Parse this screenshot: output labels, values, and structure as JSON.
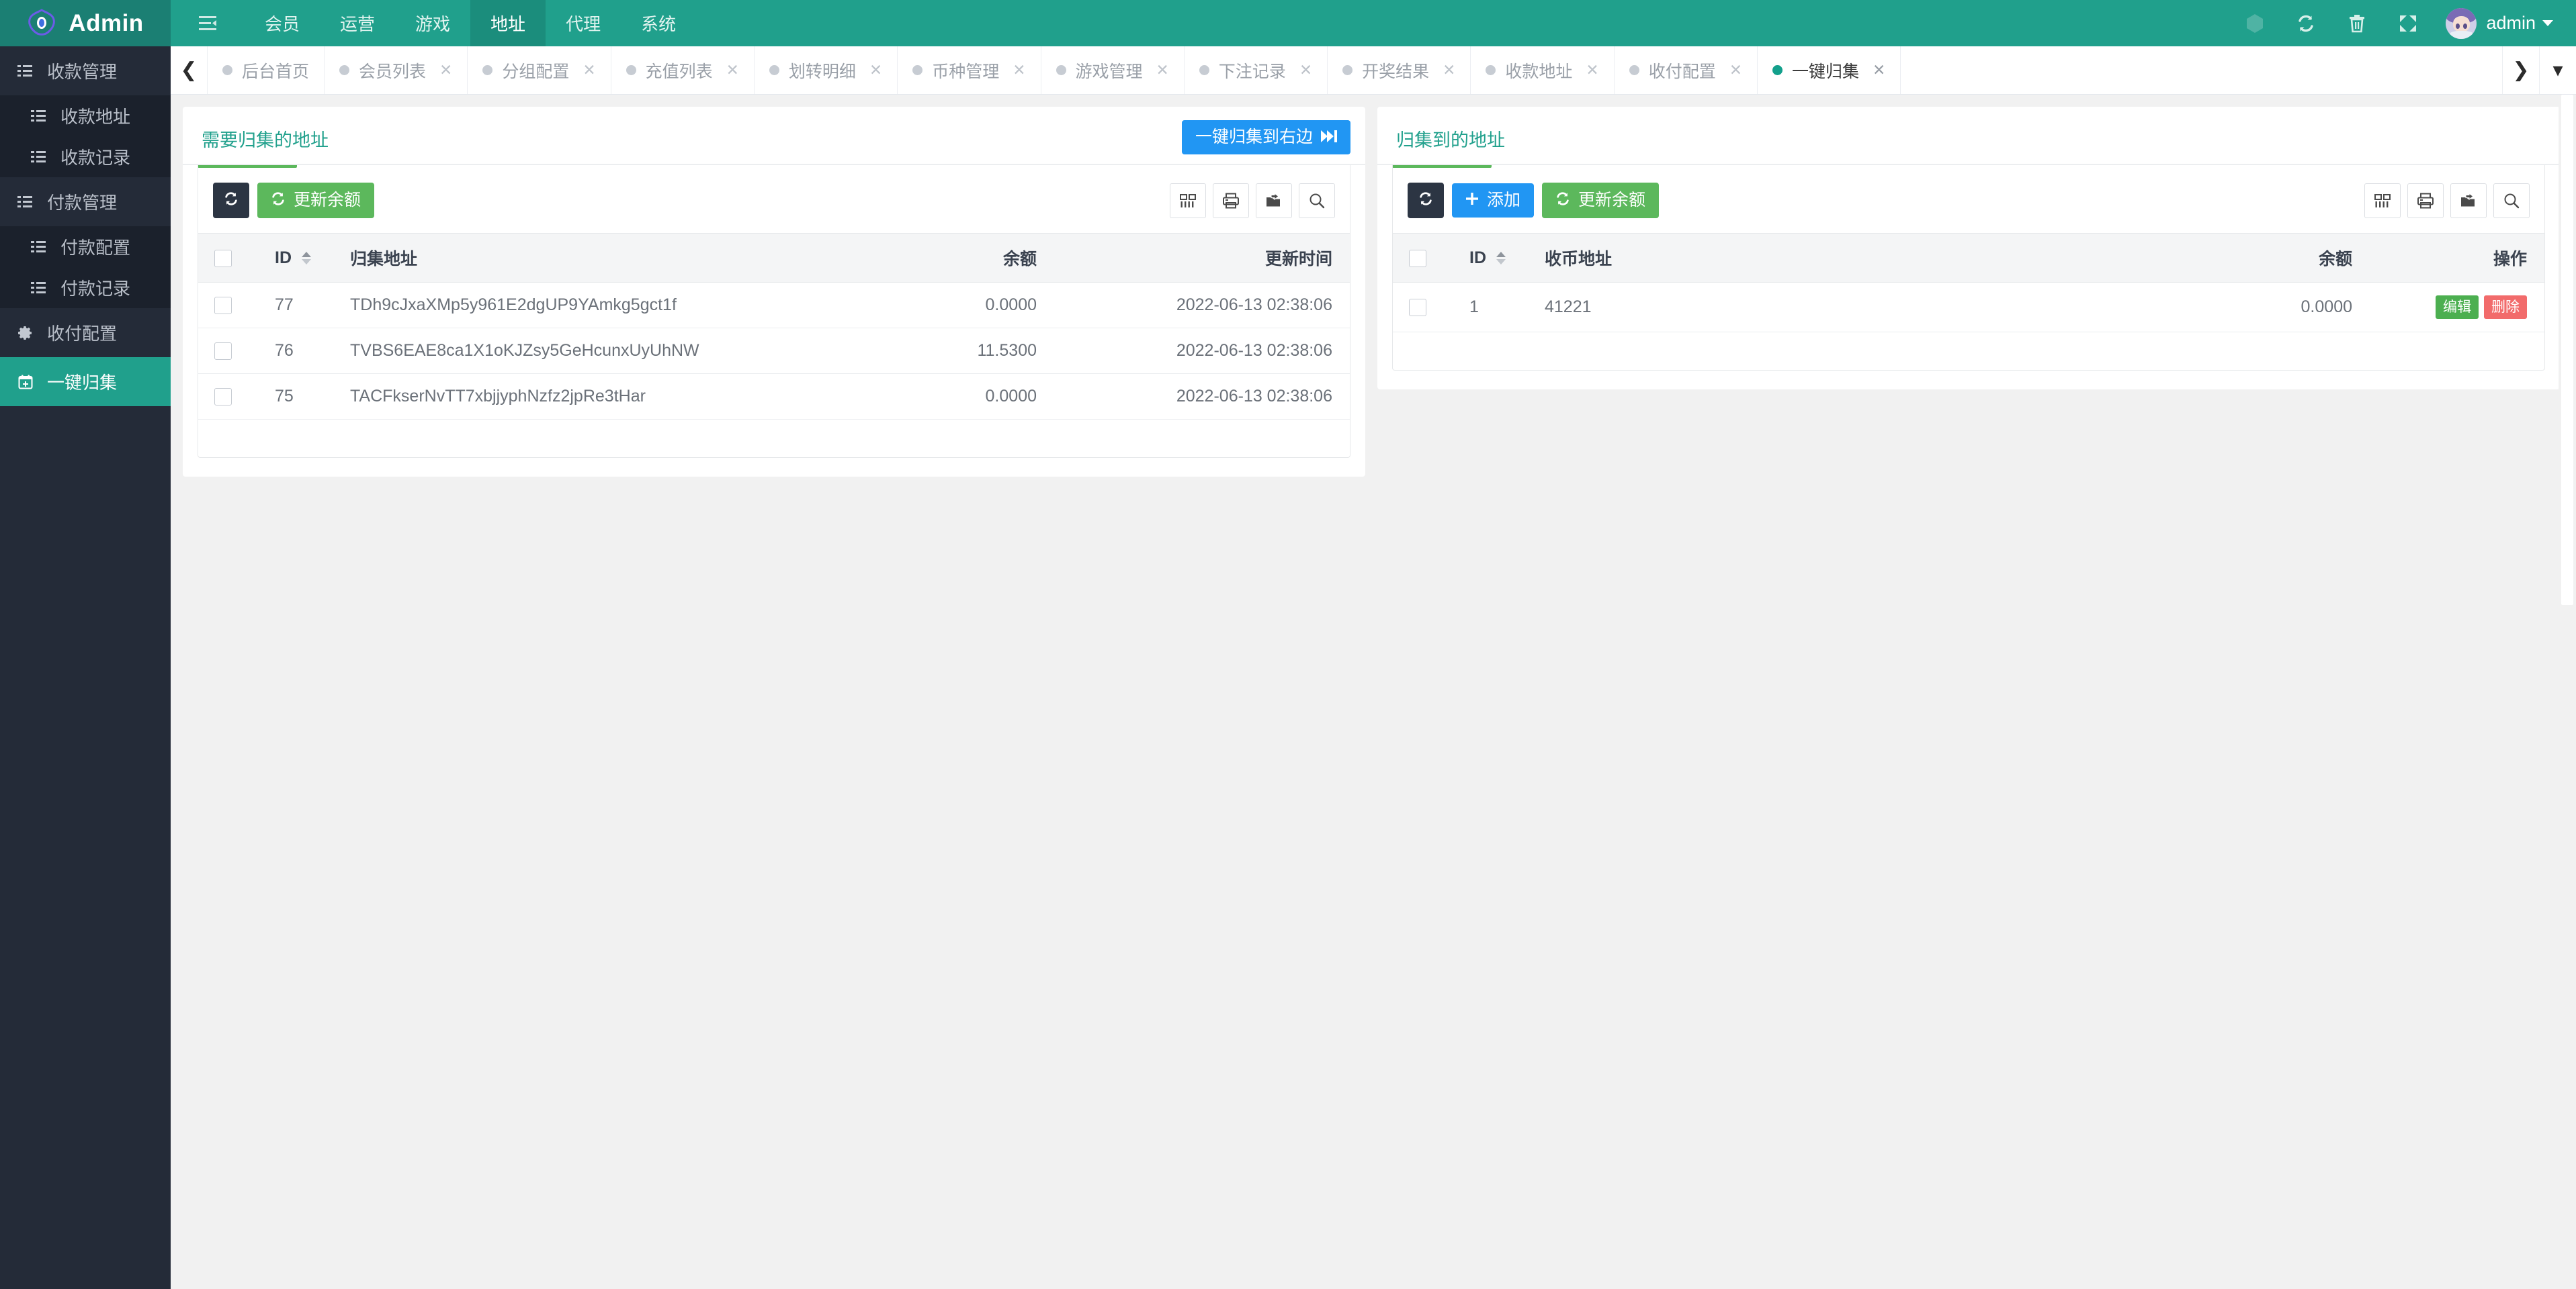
{
  "header": {
    "logo_text": "Admin",
    "logo_icon": "hexagon-eye-logo-icon",
    "collapse_icon": "menu-collapse-icon",
    "nav": [
      {
        "label": "会员",
        "active": false
      },
      {
        "label": "运营",
        "active": false
      },
      {
        "label": "游戏",
        "active": false
      },
      {
        "label": "地址",
        "active": true
      },
      {
        "label": "代理",
        "active": false
      },
      {
        "label": "系统",
        "active": false
      }
    ],
    "right_icons": [
      {
        "name": "hexagon-icon",
        "glyph": "⬢"
      },
      {
        "name": "refresh-icon",
        "glyph": "⟳"
      },
      {
        "name": "trash-icon",
        "glyph": "🗑"
      },
      {
        "name": "fullscreen-icon",
        "glyph": "⤢"
      }
    ],
    "user_name": "admin",
    "avatar_name": "user-avatar"
  },
  "tabbar": {
    "scroll_left_icon": "chevron-left-icon",
    "scroll_right_icon": "chevron-right-icon",
    "dropdown_icon": "chevron-down-icon",
    "tabs": [
      {
        "label": "后台首页",
        "active": false,
        "closable": false
      },
      {
        "label": "会员列表",
        "active": false,
        "closable": true
      },
      {
        "label": "分组配置",
        "active": false,
        "closable": true
      },
      {
        "label": "充值列表",
        "active": false,
        "closable": true
      },
      {
        "label": "划转明细",
        "active": false,
        "closable": true
      },
      {
        "label": "币种管理",
        "active": false,
        "closable": true
      },
      {
        "label": "游戏管理",
        "active": false,
        "closable": true
      },
      {
        "label": "下注记录",
        "active": false,
        "closable": true
      },
      {
        "label": "开奖结果",
        "active": false,
        "closable": true
      },
      {
        "label": "收款地址",
        "active": false,
        "closable": true
      },
      {
        "label": "收付配置",
        "active": false,
        "closable": true
      },
      {
        "label": "一键归集",
        "active": true,
        "closable": true
      }
    ]
  },
  "sidebar": {
    "items": [
      {
        "label": "收款管理",
        "icon": "list-icon",
        "type": "group",
        "active": false
      },
      {
        "label": "收款地址",
        "icon": "list-icon",
        "type": "sub",
        "active": false
      },
      {
        "label": "收款记录",
        "icon": "list-icon",
        "type": "sub",
        "active": false
      },
      {
        "label": "付款管理",
        "icon": "list-icon",
        "type": "group",
        "active": false
      },
      {
        "label": "付款配置",
        "icon": "list-icon",
        "type": "sub",
        "active": false
      },
      {
        "label": "付款记录",
        "icon": "list-icon",
        "type": "sub",
        "active": false
      },
      {
        "label": "收付配置",
        "icon": "gear-icon",
        "type": "group",
        "active": false
      },
      {
        "label": "一键归集",
        "icon": "calendar-plus-icon",
        "type": "group",
        "active": true
      }
    ]
  },
  "left_panel": {
    "tab_label": "需要归集的地址",
    "collect_button": "一键归集到右边",
    "collect_button_icon": "fast-forward-icon",
    "refresh_icon_button": "refresh-icon",
    "refresh_balance_button": "更新余额",
    "tools": [
      {
        "name": "columns-toggle-icon"
      },
      {
        "name": "print-icon"
      },
      {
        "name": "export-icon"
      },
      {
        "name": "search-icon"
      }
    ],
    "columns": [
      "",
      "ID",
      "归集地址",
      "余额",
      "更新时间"
    ],
    "rows": [
      {
        "id": "77",
        "address": "TDh9cJxaXMp5y961E2dgUP9YAmkg5gct1f",
        "balance": "0.0000",
        "updated": "2022-06-13 02:38:06"
      },
      {
        "id": "76",
        "address": "TVBS6EAE8ca1X1oKJZsy5GeHcunxUyUhNW",
        "balance": "11.5300",
        "updated": "2022-06-13 02:38:06"
      },
      {
        "id": "75",
        "address": "TACFkserNvTT7xbjjyphNzfz2jpRe3tHar",
        "balance": "0.0000",
        "updated": "2022-06-13 02:38:06"
      }
    ]
  },
  "right_panel": {
    "tab_label": "归集到的地址",
    "refresh_icon_button": "refresh-icon",
    "add_button": "添加",
    "refresh_balance_button": "更新余额",
    "tools": [
      {
        "name": "columns-toggle-icon"
      },
      {
        "name": "print-icon"
      },
      {
        "name": "export-icon"
      },
      {
        "name": "search-icon"
      }
    ],
    "columns": [
      "",
      "ID",
      "收币地址",
      "余额",
      "操作"
    ],
    "rows": [
      {
        "id": "1",
        "address": "41221",
        "balance": "0.0000",
        "edit_label": "编辑",
        "delete_label": "删除"
      }
    ]
  },
  "colors": {
    "brand_teal": "#20a08c",
    "brand_teal_dark": "#1b7f73",
    "sidebar_bg": "#242b38",
    "sidebar_sub_bg": "#1b212c",
    "accent_blue": "#2196f3",
    "accent_green": "#5cb85c",
    "danger_red": "#f26b6b",
    "page_bg": "#f1f1f1"
  }
}
